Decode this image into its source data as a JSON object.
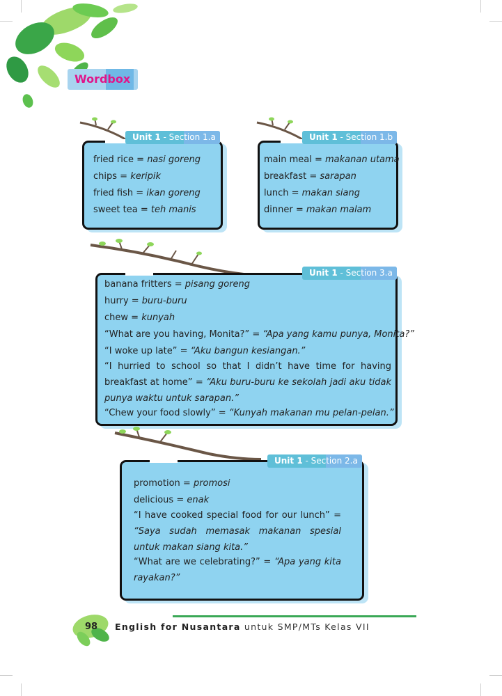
{
  "header": {
    "wordbox_label": "Wordbox"
  },
  "box_1a": {
    "tag_unit": "Unit 1",
    "tag_section": " - Section 1.a",
    "lines": [
      {
        "en": "fried rice = ",
        "id": "nasi goreng"
      },
      {
        "en": "chips = ",
        "id": "keripik"
      },
      {
        "en": "fried fish = ",
        "id": "ikan goreng"
      },
      {
        "en": "sweet tea = ",
        "id": "teh manis"
      }
    ]
  },
  "box_1b": {
    "tag_unit": "Unit 1",
    "tag_section": " - Section 1.b",
    "lines": [
      {
        "en": "main meal = ",
        "id": "makanan utama"
      },
      {
        "en": "breakfast = ",
        "id": "sarapan"
      },
      {
        "en": "lunch = ",
        "id": "makan siang"
      },
      {
        "en": "dinner = ",
        "id": "makan malam"
      }
    ]
  },
  "box_3a": {
    "tag_unit": "Unit 1",
    "tag_section": " - Section 3.a",
    "lines": [
      {
        "en": "banana fritters = ",
        "id": "pisang goreng"
      },
      {
        "en": "hurry = ",
        "id": "buru-buru"
      },
      {
        "en": "chew = ",
        "id": "kunyah"
      },
      {
        "en": "“What are you having, Monita?” = ",
        "id": "“Apa yang kamu punya, Monita?”"
      },
      {
        "en": "“I woke up late” = ",
        "id": "“Aku bangun kesiangan.”"
      }
    ],
    "para_en": "“I hurried to school so that I didn’t have time for having breakfast at home” = ",
    "para_id": "“Aku buru-buru ke sekolah jadi aku tidak punya waktu untuk sarapan.”",
    "last_en": "“Chew your food slowly” = ",
    "last_id": "“Kunyah makanan mu pelan-pelan.”"
  },
  "box_2a": {
    "tag_unit": "Unit 1",
    "tag_section": " - Section 2.a",
    "lines": [
      {
        "en": "promotion = ",
        "id": "promosi"
      },
      {
        "en": "delicious = ",
        "id": "enak"
      }
    ],
    "para1_en": "“I have cooked special food for our lunch” = ",
    "para1_id": "“Saya sudah memasak makanan spesial untuk makan siang kita.”",
    "para2_en": "“What are we celebrating?” = ",
    "para2_id": "“Apa yang kita rayakan?”"
  },
  "footer": {
    "page_number": "98",
    "title_bold": "English for Nusantara",
    "title_rest": " untuk SMP/MTs Kelas VII"
  },
  "colors": {
    "box_fill": "#8fd3f0",
    "accent_pink": "#e0168a",
    "footer_green": "#3aa856"
  }
}
